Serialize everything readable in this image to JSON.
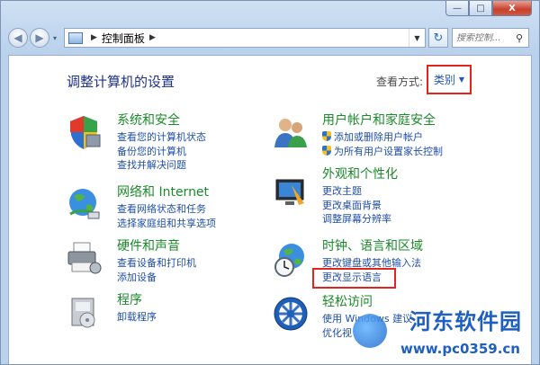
{
  "window": {
    "title_buttons": {
      "minimize": "—",
      "maximize": "□",
      "close": "X"
    }
  },
  "nav": {
    "back": "◀",
    "forward": "▶",
    "dropdown": "▾",
    "breadcrumb": [
      "控制面板"
    ],
    "refresh": "↻"
  },
  "search": {
    "placeholder": "搜索控制..."
  },
  "header": {
    "title": "调整计算机的设置",
    "view_by_label": "查看方式:",
    "view_by_value": "类别"
  },
  "categories": {
    "system": {
      "title": "系统和安全",
      "links": [
        "查看您的计算机状态",
        "备份您的计算机",
        "查找并解决问题"
      ]
    },
    "network": {
      "title": "网络和 Internet",
      "links": [
        "查看网络状态和任务",
        "选择家庭组和共享选项"
      ]
    },
    "hardware": {
      "title": "硬件和声音",
      "links": [
        "查看设备和打印机",
        "添加设备"
      ]
    },
    "programs": {
      "title": "程序",
      "links": [
        "卸载程序"
      ]
    },
    "users": {
      "title": "用户帐户和家庭安全",
      "links": [
        "添加或删除用户帐户",
        "为所有用户设置家长控制"
      ]
    },
    "appearance": {
      "title": "外观和个性化",
      "links": [
        "更改主题",
        "更改桌面背景",
        "调整屏幕分辨率"
      ]
    },
    "clock": {
      "title": "时钟、语言和区域",
      "links": [
        "更改键盘或其他输入法",
        "更改显示语言"
      ]
    },
    "ease": {
      "title": "轻松访问",
      "links": [
        "使用 Windows 建议",
        "优化视"
      ]
    }
  },
  "watermark": {
    "name": "河东软件园",
    "url": "www.pc0359.cn"
  },
  "colors": {
    "highlight": "#e1251b",
    "category_title": "#1a8a2a",
    "link": "#1f4ea8"
  }
}
